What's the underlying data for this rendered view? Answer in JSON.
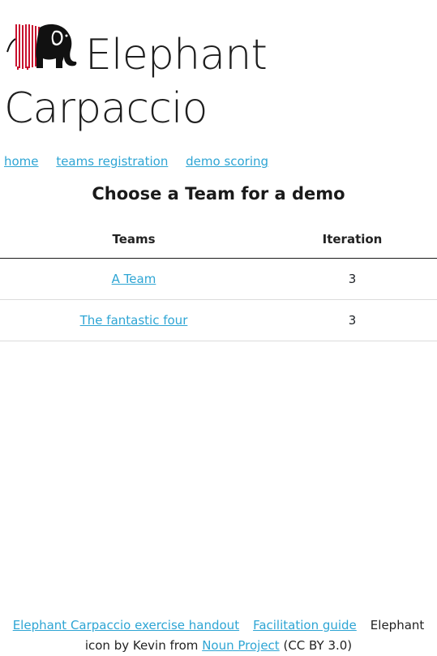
{
  "header": {
    "title": "Elephant Carpaccio",
    "logo_icon": "elephant-icon"
  },
  "nav": {
    "items": [
      {
        "label": "home"
      },
      {
        "label": "teams registration"
      },
      {
        "label": "demo scoring"
      }
    ]
  },
  "main": {
    "heading": "Choose a Team for a demo",
    "table": {
      "columns": [
        "Teams",
        "Iteration"
      ],
      "rows": [
        {
          "team": "A Team",
          "iteration": "3"
        },
        {
          "team": "The fantastic four",
          "iteration": "3"
        }
      ]
    }
  },
  "footer": {
    "handout_link": "Elephant Carpaccio exercise handout",
    "guide_link": "Facilitation guide",
    "credit_prefix": "Elephant icon by Kevin from",
    "noun_project_link": "Noun Project",
    "license": "(CC BY 3.0)"
  },
  "colors": {
    "link": "#2ea5d4",
    "logo_red": "#c8102e",
    "text": "#1e1e1e"
  }
}
